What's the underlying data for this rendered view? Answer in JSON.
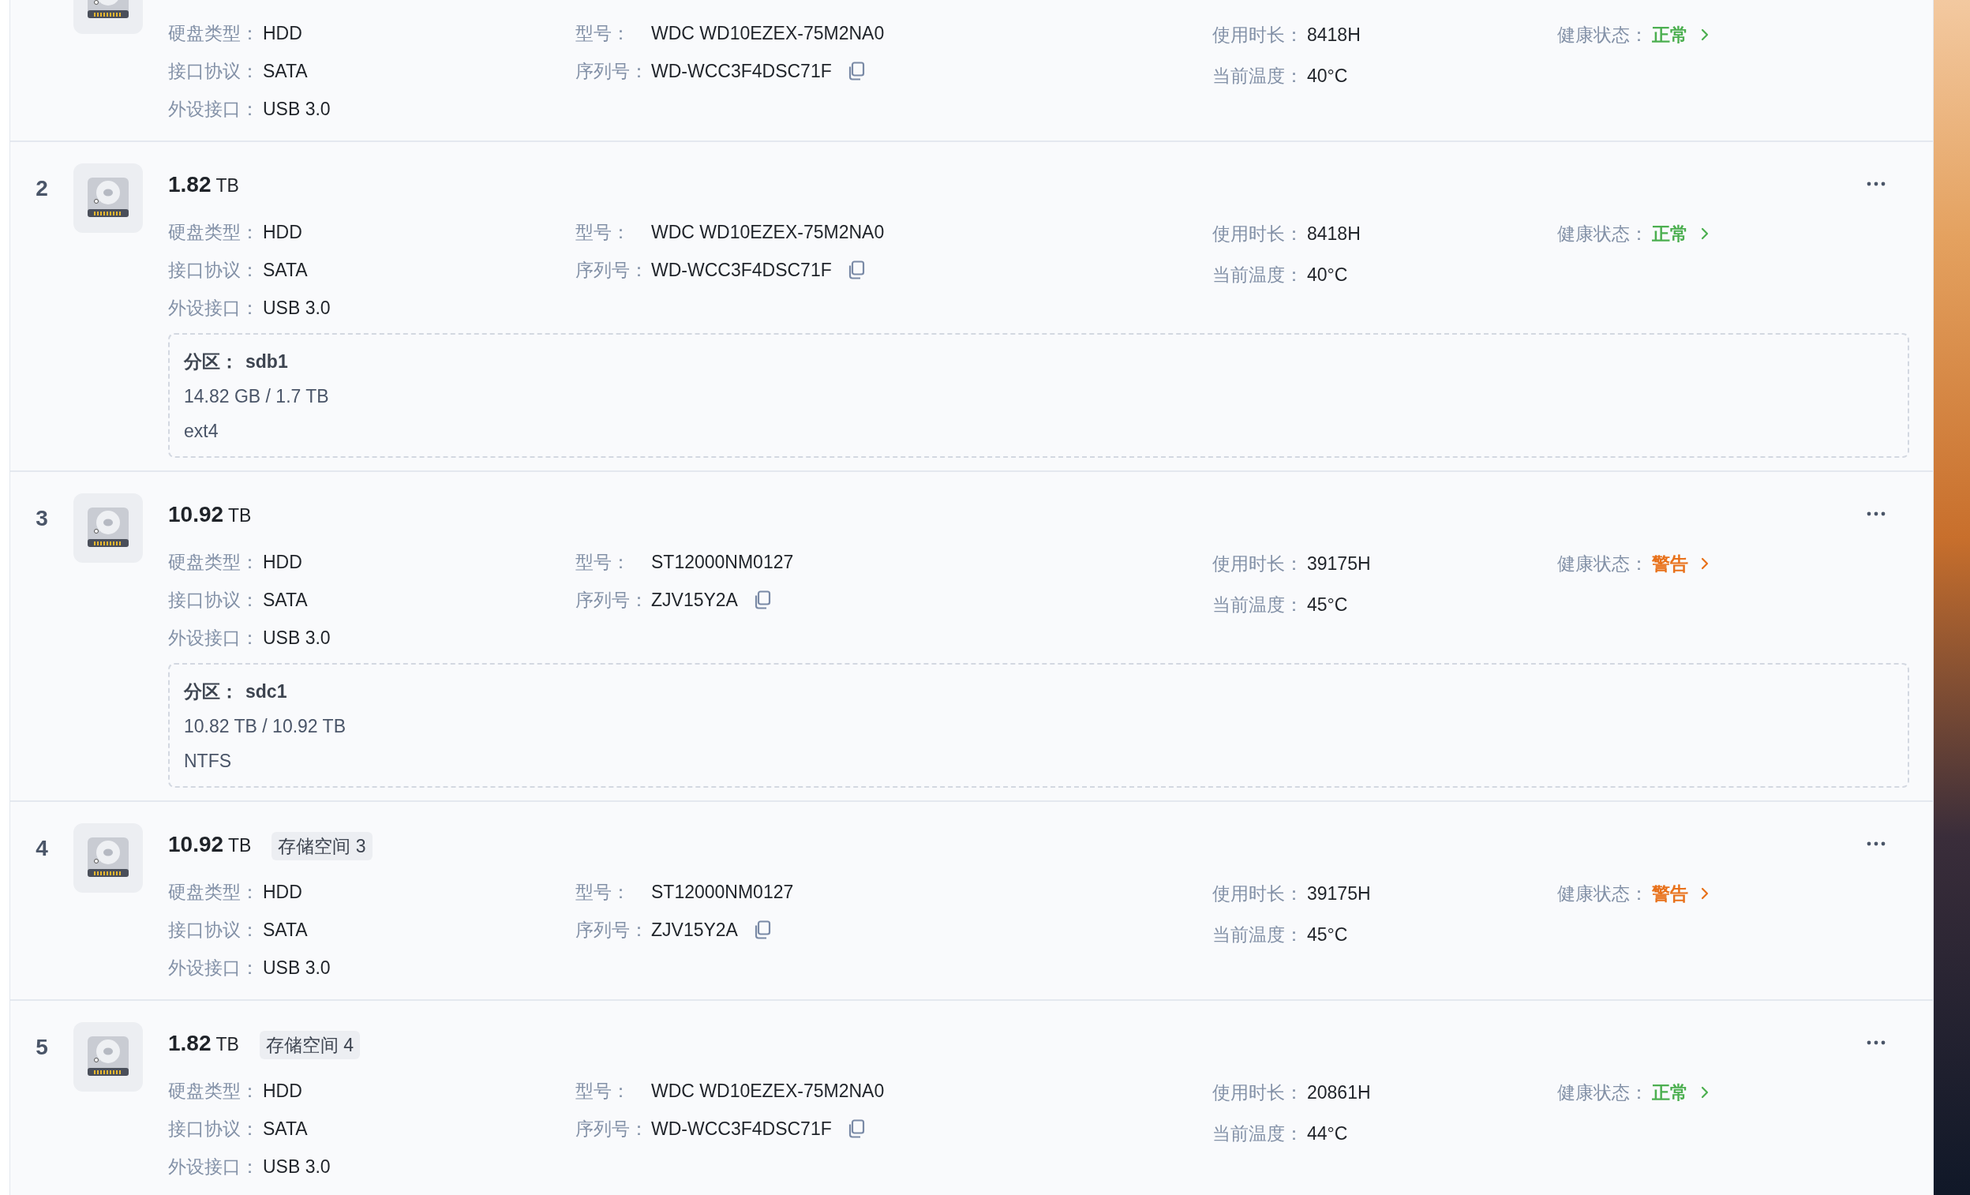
{
  "disks": [
    {
      "columns": [
        [
          {
            "kind": "text",
            "label": "硬盘类型：",
            "value": "HDD"
          },
          {
            "kind": "text",
            "label": "接口协议：",
            "value": "SATA"
          },
          {
            "kind": "text",
            "label": "外设接口：",
            "value": "USB 3.0"
          }
        ],
        [
          {
            "kind": "text",
            "label": "型号：",
            "value": "WDC WD10EZEX-75M2NA0"
          },
          {
            "kind": "copy",
            "label": "序列号：",
            "value": "WD-WCC3F4DSC71F"
          }
        ],
        [
          {
            "kind": "text",
            "label": "使用时长：",
            "value": "8418H"
          },
          {
            "kind": "text",
            "label": "当前温度：",
            "value": "40°C"
          }
        ],
        [
          {
            "kind": "healthy",
            "label": "健康状态：",
            "value": "正常"
          }
        ]
      ]
    },
    {
      "index": "2",
      "size": "1.82",
      "unit": "TB",
      "columns": [
        [
          {
            "kind": "text",
            "label": "硬盘类型：",
            "value": "HDD"
          },
          {
            "kind": "text",
            "label": "接口协议：",
            "value": "SATA"
          },
          {
            "kind": "text",
            "label": "外设接口：",
            "value": "USB 3.0"
          }
        ],
        [
          {
            "kind": "text",
            "label": "型号：",
            "value": "WDC WD10EZEX-75M2NA0"
          },
          {
            "kind": "copy",
            "label": "序列号：",
            "value": "WD-WCC3F4DSC71F"
          }
        ],
        [
          {
            "kind": "text",
            "label": "使用时长：",
            "value": "8418H"
          },
          {
            "kind": "text",
            "label": "当前温度：",
            "value": "40°C"
          }
        ],
        [
          {
            "kind": "healthy",
            "label": "健康状态：",
            "value": "正常"
          }
        ]
      ],
      "partition": {
        "label": "分区：",
        "name": "sdb1",
        "usage": "14.82 GB / 1.7 TB",
        "filesystem": "ext4"
      }
    },
    {
      "index": "3",
      "size": "10.92",
      "unit": "TB",
      "columns": [
        [
          {
            "kind": "text",
            "label": "硬盘类型：",
            "value": "HDD"
          },
          {
            "kind": "text",
            "label": "接口协议：",
            "value": "SATA"
          },
          {
            "kind": "text",
            "label": "外设接口：",
            "value": "USB 3.0"
          }
        ],
        [
          {
            "kind": "text",
            "label": "型号：",
            "value": "ST12000NM0127"
          },
          {
            "kind": "copy",
            "label": "序列号：",
            "value": "ZJV15Y2A"
          }
        ],
        [
          {
            "kind": "text",
            "label": "使用时长：",
            "value": "39175H"
          },
          {
            "kind": "text",
            "label": "当前温度：",
            "value": "45°C"
          }
        ],
        [
          {
            "kind": "warning",
            "label": "健康状态：",
            "value": "警告"
          }
        ]
      ],
      "partition": {
        "label": "分区：",
        "name": "sdc1",
        "usage": "10.82 TB / 10.92 TB",
        "filesystem": "NTFS"
      }
    },
    {
      "index": "4",
      "size": "10.92",
      "unit": "TB",
      "tag": "存储空间 3",
      "columns": [
        [
          {
            "kind": "text",
            "label": "硬盘类型：",
            "value": "HDD"
          },
          {
            "kind": "text",
            "label": "接口协议：",
            "value": "SATA"
          },
          {
            "kind": "text",
            "label": "外设接口：",
            "value": "USB 3.0"
          }
        ],
        [
          {
            "kind": "text",
            "label": "型号：",
            "value": "ST12000NM0127"
          },
          {
            "kind": "copy",
            "label": "序列号：",
            "value": "ZJV15Y2A"
          }
        ],
        [
          {
            "kind": "text",
            "label": "使用时长：",
            "value": "39175H"
          },
          {
            "kind": "text",
            "label": "当前温度：",
            "value": "45°C"
          }
        ],
        [
          {
            "kind": "warning",
            "label": "健康状态：",
            "value": "警告"
          }
        ]
      ]
    },
    {
      "index": "5",
      "size": "1.82",
      "unit": "TB",
      "tag": "存储空间 4",
      "columns": [
        [
          {
            "kind": "text",
            "label": "硬盘类型：",
            "value": "HDD"
          },
          {
            "kind": "text",
            "label": "接口协议：",
            "value": "SATA"
          },
          {
            "kind": "text",
            "label": "外设接口：",
            "value": "USB 3.0"
          }
        ],
        [
          {
            "kind": "text",
            "label": "型号：",
            "value": "WDC WD10EZEX-75M2NA0"
          },
          {
            "kind": "copy",
            "label": "序列号：",
            "value": "WD-WCC3F4DSC71F"
          }
        ],
        [
          {
            "kind": "text",
            "label": "使用时长：",
            "value": "20861H"
          },
          {
            "kind": "text",
            "label": "当前温度：",
            "value": "44°C"
          }
        ],
        [
          {
            "kind": "healthy",
            "label": "健康状态：",
            "value": "正常"
          }
        ]
      ]
    }
  ]
}
